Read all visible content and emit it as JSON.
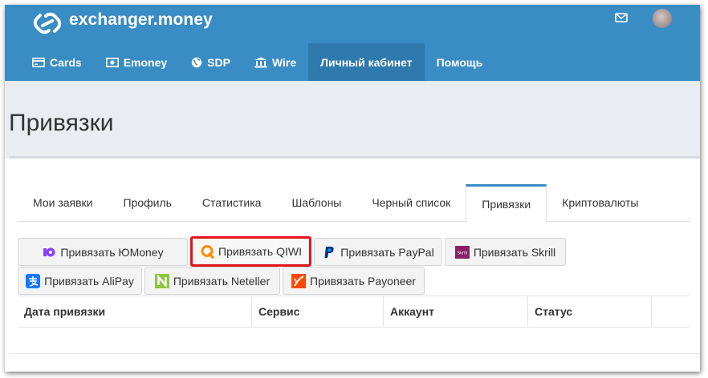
{
  "brand": {
    "name": "exchanger.money",
    "logo_icon": "link-icon"
  },
  "header_icons": {
    "mail": "mail-icon",
    "avatar": "user-avatar"
  },
  "nav": {
    "items": [
      {
        "label": "Cards",
        "icon": "card-icon"
      },
      {
        "label": "Emoney",
        "icon": "money-icon"
      },
      {
        "label": "SDP",
        "icon": "globe-icon"
      },
      {
        "label": "Wire",
        "icon": "bank-icon"
      },
      {
        "label": "Личный кабинет",
        "active": true
      },
      {
        "label": "Помощь"
      }
    ]
  },
  "page": {
    "title": "Привязки"
  },
  "tabs": [
    {
      "label": "Мои заявки"
    },
    {
      "label": "Профиль"
    },
    {
      "label": "Статистика"
    },
    {
      "label": "Шаблоны"
    },
    {
      "label": "Черный список"
    },
    {
      "label": "Привязки",
      "active": true
    },
    {
      "label": "Криптовалюты"
    }
  ],
  "bind_buttons": [
    {
      "label": "Привязать ЮMoney",
      "icon": "yoomoney-icon",
      "color": "#8b3ffd"
    },
    {
      "label": "Привязать QIWI",
      "icon": "qiwi-icon",
      "color": "#ff8c00",
      "highlighted": true,
      "highlight_color": "#e3131b"
    },
    {
      "label": "Привязать PayPal",
      "icon": "paypal-icon",
      "color": "#003087"
    },
    {
      "label": "Привязать Skrill",
      "icon": "skrill-icon",
      "color": "#862165"
    },
    {
      "label": "Привязать AliPay",
      "icon": "alipay-icon",
      "color": "#1677ff"
    },
    {
      "label": "Привязать Neteller",
      "icon": "neteller-icon",
      "color": "#8dc63f"
    },
    {
      "label": "Привязать Payoneer",
      "icon": "payoneer-icon",
      "color": "#ff4800"
    }
  ],
  "table": {
    "columns": [
      "Дата привязки",
      "Сервис",
      "Аккаунт",
      "Статус",
      ""
    ]
  },
  "colors": {
    "header": "#3a8cc4",
    "active_nav": "#2e79ad",
    "band": "#e9edf2"
  }
}
